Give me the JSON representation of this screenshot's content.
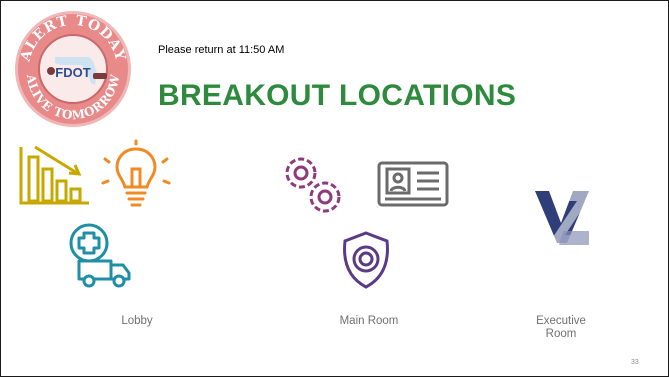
{
  "slide": {
    "return_notice": "Please return at 11:50 AM",
    "title": "BREAKOUT LOCATIONS",
    "page_number": "33",
    "title_color": "#2e8b3e"
  },
  "logo": {
    "top_text": "ALERT TODAY",
    "center_text": "FDOT",
    "bottom_text": "ALIVE TOMORROW",
    "ring_color": "#e8898a"
  },
  "locations": [
    {
      "label": "Lobby",
      "icons": [
        "declining-chart-icon",
        "lightbulb-icon",
        "medical-truck-icon"
      ]
    },
    {
      "label": "Main Room",
      "icons": [
        "gears-icon",
        "id-card-icon",
        "shield-badge-icon"
      ]
    },
    {
      "label_line1": "Executive",
      "label_line2": "Room",
      "icons": [
        "vz-logo-icon"
      ]
    }
  ]
}
